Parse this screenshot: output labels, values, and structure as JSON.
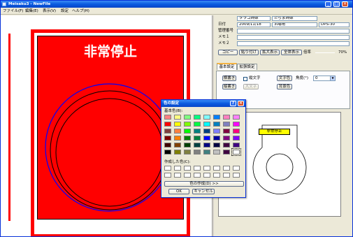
{
  "window": {
    "title": "Meisaku3 - NewFile",
    "min": "_",
    "max": "□",
    "close": "×"
  },
  "menu": [
    "ファイル(F)",
    "編集(E)",
    "表示(V)",
    "設定",
    "ヘルプ(H)"
  ],
  "sign": {
    "text": "非常停止",
    "colors": {
      "plate": "#ff0000",
      "border": "#ff0000",
      "text": "#ffffff",
      "circle_outer": "#0000ff",
      "circle_inner": "#000000"
    }
  },
  "panel": {
    "row0_fields": [
      "タラコ姉妹",
      "たらま姉妹"
    ],
    "date_label": "日付",
    "date_value": "2009/11/18",
    "date_extra": "30φ用",
    "code_value": "DPS-30",
    "mgmt_label": "管理番号",
    "memo1_label": "メモ１",
    "memo2_label": "メモ２",
    "buttons": [
      "コピー",
      "貼り付け",
      "拡大表示",
      "全体表示"
    ],
    "zoom_label": "倍率",
    "zoom_value": "70%",
    "tabs": [
      "基本設定",
      "拡張設定"
    ],
    "horizontal_btn": "横書き",
    "vertical_btn": "縦書き",
    "vertical_text_chk": "縦文字",
    "large_text_btn": "大文字",
    "text_color_btn": "文字色",
    "bg_color_btn": "背景色",
    "angle_label": "角度(°)",
    "angle_value": "0",
    "angle_arrow": "▼",
    "preview_label": "非常停止"
  },
  "dialog": {
    "title": "色の設定",
    "help": "?",
    "close": "×",
    "basic_colors_label": "基本色(B):",
    "basic_colors": [
      "#ff8080",
      "#ffff80",
      "#80ff80",
      "#00ff80",
      "#80ffff",
      "#0080ff",
      "#ff80c0",
      "#ff80ff",
      "#ff0000",
      "#ffff00",
      "#80ff00",
      "#00ff40",
      "#00ffff",
      "#0080c0",
      "#8080c0",
      "#ff00ff",
      "#804040",
      "#ff8040",
      "#00ff00",
      "#008080",
      "#004080",
      "#8080ff",
      "#800040",
      "#ff0080",
      "#800000",
      "#ff8000",
      "#008000",
      "#008040",
      "#0000ff",
      "#0000a0",
      "#800080",
      "#8000ff",
      "#400000",
      "#804000",
      "#004000",
      "#004040",
      "#000080",
      "#000040",
      "#400040",
      "#400080",
      "#000000",
      "#808000",
      "#808040",
      "#808080",
      "#408080",
      "#c0c0c0",
      "#400040",
      "#ffffff"
    ],
    "custom_colors_label": "作成した色(C):",
    "define_btn": "色の作成(D) >>",
    "ok": "OK",
    "cancel": "キャンセル"
  }
}
